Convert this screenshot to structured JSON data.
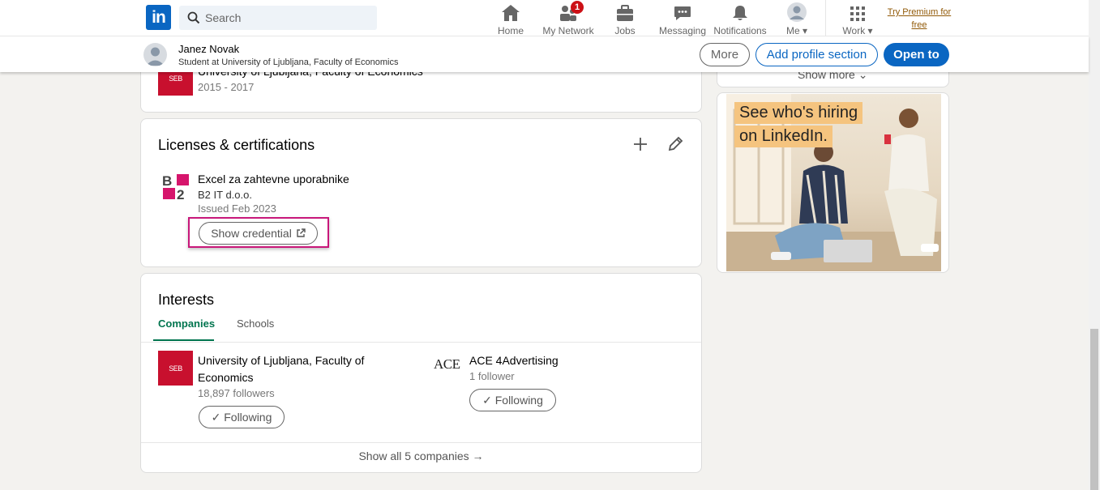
{
  "nav": {
    "search_placeholder": "Search",
    "items": [
      {
        "label": "Home",
        "icon": "home-icon"
      },
      {
        "label": "My Network",
        "icon": "network-icon",
        "badge": "1"
      },
      {
        "label": "Jobs",
        "icon": "briefcase-icon"
      },
      {
        "label": "Messaging",
        "icon": "messaging-icon"
      },
      {
        "label": "Notifications",
        "icon": "bell-icon"
      },
      {
        "label": "Me",
        "icon": "avatar-icon"
      },
      {
        "label": "Work",
        "icon": "grid-icon"
      }
    ],
    "premium": "Try Premium for free"
  },
  "profile_bar": {
    "name": "Janez Novak",
    "headline": "Student at University of Ljubljana, Faculty of Economics",
    "more": "More",
    "add_section": "Add profile section",
    "open_to": "Open to"
  },
  "education": {
    "logo_text": "SEB",
    "school": "University of Ljubljana, Faculty of Economics",
    "dates": "2015 - 2017"
  },
  "licenses": {
    "title": "Licenses & certifications",
    "item": {
      "name": "Excel za zahtevne uporabnike",
      "issuer": "B2 IT d.o.o.",
      "issued": "Issued Feb 2023",
      "button": "Show credential"
    }
  },
  "interests": {
    "title": "Interests",
    "tabs": [
      "Companies",
      "Schools"
    ],
    "companies": [
      {
        "name_line1": "University of Ljubljana, Faculty of",
        "name_line2": "Economics",
        "followers": "18,897 followers",
        "button": "Following",
        "logo": "SEB"
      },
      {
        "name_line1": "ACE 4Advertising",
        "followers": "1 follower",
        "button": "Following",
        "logo": "ACE"
      }
    ],
    "show_all": "Show all 5 companies"
  },
  "sidebar": {
    "show_more": "Show more",
    "ad_line1": "See who's hiring",
    "ad_line2": "on LinkedIn."
  },
  "colors": {
    "brand": "#0a66c2",
    "green": "#01754f",
    "highlight": "#c8177a",
    "badge": "#cc1016"
  }
}
